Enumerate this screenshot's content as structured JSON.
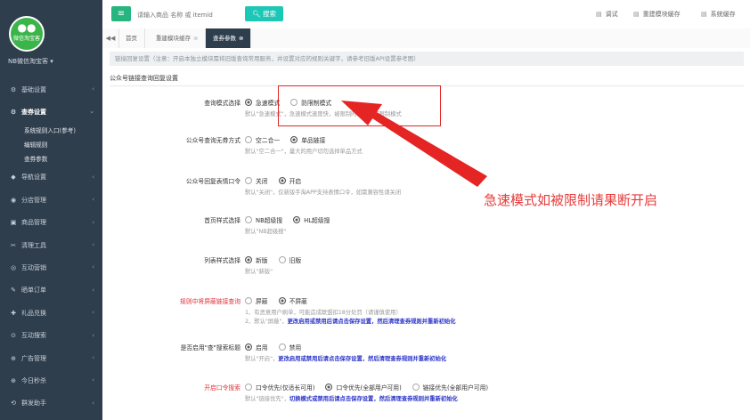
{
  "app": {
    "logo_text": "微信淘宝客",
    "account": "NB微信淘宝客 ▾"
  },
  "colors": {
    "sidebar": "#2f3e4d",
    "accent": "#26b47f",
    "search": "#1cc7b6",
    "annotation": "#e52424"
  },
  "sidebar": {
    "items": [
      {
        "icon": "gear-icon",
        "glyph": "⚙",
        "label": "基础设置",
        "expanded": false
      },
      {
        "icon": "gear-icon",
        "glyph": "⚙",
        "label": "查券设置",
        "expanded": true,
        "children": [
          "系统规则入口(参考)",
          "编辑规则",
          "查券参数"
        ]
      },
      {
        "icon": "nav-icon",
        "glyph": "◆",
        "label": "导航设置"
      },
      {
        "icon": "store-icon",
        "glyph": "◉",
        "label": "分店管理"
      },
      {
        "icon": "goods-icon",
        "glyph": "▣",
        "label": "商品管理"
      },
      {
        "icon": "tools-icon",
        "glyph": "✂",
        "label": "清理工具"
      },
      {
        "icon": "marketing-icon",
        "glyph": "◎",
        "label": "互动营销"
      },
      {
        "icon": "order-icon",
        "glyph": "✎",
        "label": "晒单订单"
      },
      {
        "icon": "gift-icon",
        "glyph": "✚",
        "label": "礼品兑换"
      },
      {
        "icon": "search-icon",
        "glyph": "⊙",
        "label": "互动搜索"
      },
      {
        "icon": "ad-icon",
        "glyph": "⊕",
        "label": "广告管理"
      },
      {
        "icon": "flash-icon",
        "glyph": "⊕",
        "label": "今日秒杀"
      },
      {
        "icon": "assistant-icon",
        "glyph": "⟲",
        "label": "群发助手"
      }
    ]
  },
  "topbar": {
    "menu_icon": "≡",
    "search_placeholder": "请输入商品 名称 或 itemid",
    "search_button": "搜索",
    "links": [
      {
        "icon": "debug-icon",
        "glyph": "▤",
        "label": "调试"
      },
      {
        "icon": "rebuild-icon",
        "glyph": "▤",
        "label": "重建模块缓存"
      },
      {
        "icon": "cache-icon",
        "glyph": "▤",
        "label": "系统缓存"
      }
    ]
  },
  "tabs": [
    {
      "label": "首页",
      "active": false,
      "closable": false
    },
    {
      "label": "重建模块缓存",
      "active": false,
      "closable": true
    },
    {
      "label": "查券参数",
      "active": true,
      "closable": true
    }
  ],
  "notice": "链接回复设置（注意：开启本独立模块需将旧版查询常用服务，并设置对应的规则关键字，请参考旧版API设置参考图）",
  "section_title": "公众号链接查询回复设置",
  "form": [
    {
      "label": "查询模式选择",
      "red": false,
      "options": [
        {
          "text": "急速模式",
          "checked": true
        },
        {
          "text": "防限制模式",
          "checked": false
        }
      ],
      "help": [
        "默认\"急速模式\"，急速模式速度快，被限制时请选择防限制模式"
      ]
    },
    {
      "label": "公众号查询无券方式",
      "red": false,
      "options": [
        {
          "text": "空二合一",
          "checked": false
        },
        {
          "text": "单品链接",
          "checked": true
        }
      ],
      "help": [
        "默认\"空二合一\"，量大的用户切勿选择单品方式"
      ]
    },
    {
      "label": "公众号回复表情口令",
      "red": false,
      "options": [
        {
          "text": "关闭",
          "checked": false
        },
        {
          "text": "开启",
          "checked": true
        }
      ],
      "help": [
        "默认\"关闭\"，仅新版手淘APP支持表情口令，如需兼容性请关闭"
      ]
    },
    {
      "label": "首页样式选择",
      "red": false,
      "options": [
        {
          "text": "NB超级搜",
          "checked": false
        },
        {
          "text": "HL超级搜",
          "checked": true
        }
      ],
      "help": [
        "默认\"NB超级搜\""
      ]
    },
    {
      "label": "列表样式选择",
      "red": false,
      "options": [
        {
          "text": "新版",
          "checked": true
        },
        {
          "text": "旧版",
          "checked": false
        }
      ],
      "help": [
        "默认\"新版\""
      ]
    },
    {
      "label": "规则中将屏蔽链接查询",
      "red": true,
      "options": [
        {
          "text": "屏蔽",
          "checked": false
        },
        {
          "text": "不屏蔽",
          "checked": true
        }
      ],
      "help": [
        "1、有恶意用户刷单，可能造成联盟扣18分处罚（请谨慎使用）",
        "2、默认\"屏蔽\"，|更改启用或禁用后请点击保存设置，然后清理查券规则并重新初始化"
      ]
    },
    {
      "label": "是否启用\"查\"搜索标题",
      "red": false,
      "options": [
        {
          "text": "启用",
          "checked": true
        },
        {
          "text": "禁用",
          "checked": false
        }
      ],
      "help": [
        "默认\"开启\"，|更改启用或禁用后请点击保存设置，然后清理查券规则并重新初始化"
      ]
    },
    {
      "label": "开启口令搜索",
      "red": true,
      "options": [
        {
          "text": "口令优先(仅适长可用)",
          "checked": false
        },
        {
          "text": "口令优先(全部用户可用)",
          "checked": true
        },
        {
          "text": "链接优先(全部用户可用)",
          "checked": false
        }
      ],
      "help": [
        "默认\"链接优先\"，|切换模式或禁用后请点击保存设置，然后清理查券规则并重新初始化"
      ]
    }
  ],
  "annotation": {
    "text": "急速模式如被限制请果断开启"
  }
}
